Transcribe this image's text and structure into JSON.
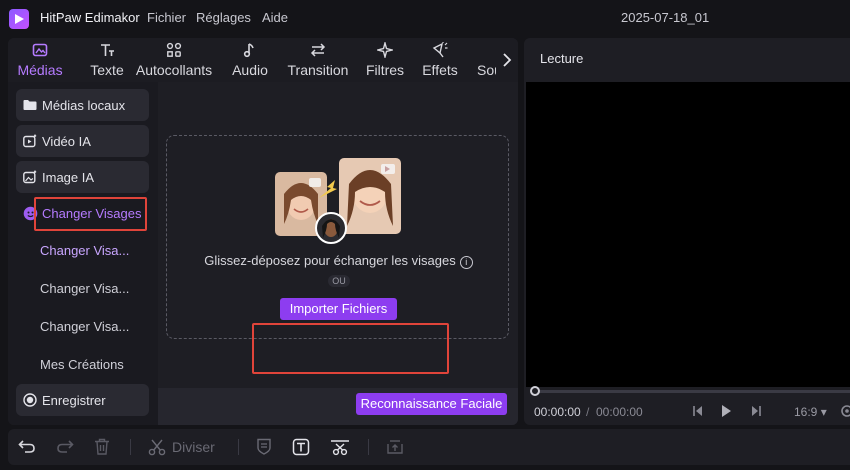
{
  "app": {
    "name": "HitPaw Edimakor",
    "menu": [
      "Fichier",
      "Réglages",
      "Aide"
    ],
    "project_title": "2025-07-18_01"
  },
  "tabs": [
    {
      "label": "Médias",
      "icon": "media-icon",
      "active": true
    },
    {
      "label": "Texte",
      "icon": "text-icon"
    },
    {
      "label": "Autocollants",
      "icon": "stickers-icon"
    },
    {
      "label": "Audio",
      "icon": "music-note-icon"
    },
    {
      "label": "Transition",
      "icon": "transition-arrows-icon"
    },
    {
      "label": "Filtres",
      "icon": "sparkle-icon"
    },
    {
      "label": "Effets",
      "icon": "magic-wand-icon"
    },
    {
      "label": "Sou",
      "icon": ""
    }
  ],
  "sidebar": {
    "items": [
      {
        "label": "Médias locaux",
        "icon": "folder-icon"
      },
      {
        "label": "Vidéo IA",
        "icon": "ai-video-icon"
      },
      {
        "label": "Image IA",
        "icon": "ai-image-icon"
      },
      {
        "label": "Changer Visages",
        "icon": "face-swap-icon",
        "active": true
      }
    ],
    "sub_items": [
      {
        "label": "Changer Visa...",
        "active": true
      },
      {
        "label": "Changer Visa..."
      },
      {
        "label": "Changer Visa..."
      },
      {
        "label": "Mes Créations"
      }
    ],
    "record": {
      "label": "Enregistrer",
      "icon": "record-icon"
    }
  },
  "content": {
    "drop_text": "Glissez-déposez pour échanger les visages",
    "or_label": "OU",
    "import_button": "Importer Fichiers",
    "face_recognition_button": "Reconnaissance Faciale"
  },
  "player": {
    "title": "Lecture",
    "current_time": "00:00:00",
    "separator": "/",
    "total_time": "00:00:00",
    "aspect_ratio": "16:9 ▾"
  },
  "toolbar": {
    "split_label": "Diviser"
  },
  "colors": {
    "accent": "#8d3df0",
    "accent_text": "#b57bff",
    "highlight": "#e0443a",
    "background": "#141418",
    "panel": "#1e1e24"
  }
}
